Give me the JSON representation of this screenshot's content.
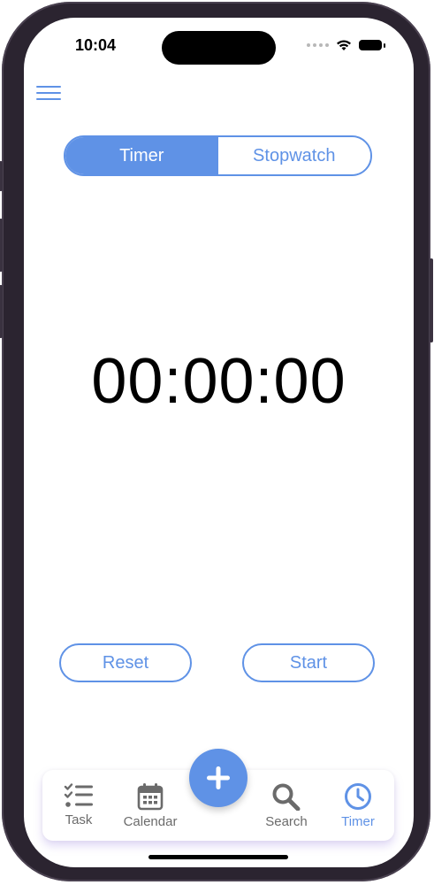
{
  "status_bar": {
    "time": "10:04"
  },
  "header": {
    "menu_icon": "hamburger-menu-icon"
  },
  "mode_toggle": {
    "options": [
      {
        "label": "Timer",
        "selected": true
      },
      {
        "label": "Stopwatch",
        "selected": false
      }
    ]
  },
  "timer": {
    "display": "00:00:00"
  },
  "controls": {
    "reset_label": "Reset",
    "start_label": "Start"
  },
  "tab_bar": {
    "items": [
      {
        "label": "Task",
        "icon": "task-list-icon",
        "active": false
      },
      {
        "label": "Calendar",
        "icon": "calendar-icon",
        "active": false
      },
      {
        "label": "Search",
        "icon": "search-icon",
        "active": false
      },
      {
        "label": "Timer",
        "icon": "clock-icon",
        "active": true
      }
    ],
    "add_icon": "plus-icon"
  },
  "colors": {
    "accent": "#5f92e6",
    "inactive_tab": "#6b6b6b",
    "text": "#000000"
  }
}
